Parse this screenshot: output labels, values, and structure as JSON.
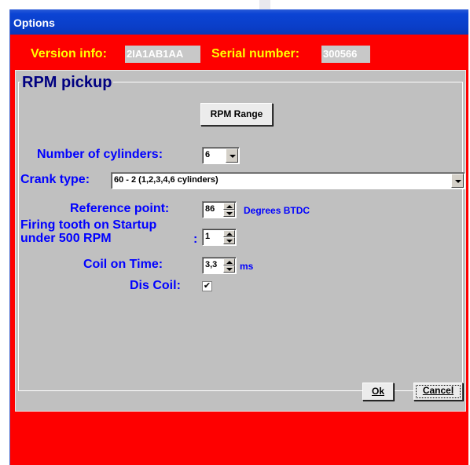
{
  "window": {
    "title": "Options"
  },
  "info": {
    "version_label": "Version info:",
    "version_value": "2IA1AB1AA",
    "serial_label": "Serial number:",
    "serial_value": "300566"
  },
  "group": {
    "title": "RPM pickup",
    "rpm_range_button": "RPM Range",
    "cylinders_label": "Number of cylinders:",
    "cylinders_value": "6",
    "crank_label": "Crank type:",
    "crank_value": "60 - 2  (1,2,3,4,6 cylinders)",
    "reference_label": "Reference point:",
    "reference_value": "86",
    "reference_unit": "Degrees BTDC",
    "firing_label_line1": "Firing tooth on Startup",
    "firing_label_line2": "under 500 RPM",
    "firing_colon": ":",
    "firing_value": "1",
    "coil_label": "Coil on Time:",
    "coil_value": "3,3",
    "coil_unit": "ms",
    "dis_coil_label": "Dis Coil:",
    "dis_coil_checked": true,
    "check_glyph": "✔"
  },
  "buttons": {
    "ok": "Ok",
    "cancel": "Cancel"
  },
  "colors": {
    "background": "#fe0000",
    "titlebar": "#0a3ec8",
    "label": "#0000ff",
    "info_label": "#ffff00",
    "panel": "#c0c0c0"
  }
}
